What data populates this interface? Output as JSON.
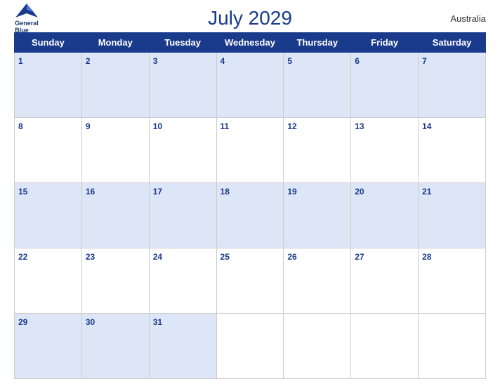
{
  "header": {
    "title": "July 2029",
    "country": "Australia",
    "logo_line1": "General",
    "logo_line2": "Blue"
  },
  "weekdays": [
    "Sunday",
    "Monday",
    "Tuesday",
    "Wednesday",
    "Thursday",
    "Friday",
    "Saturday"
  ],
  "weeks": [
    [
      1,
      2,
      3,
      4,
      5,
      6,
      7
    ],
    [
      8,
      9,
      10,
      11,
      12,
      13,
      14
    ],
    [
      15,
      16,
      17,
      18,
      19,
      20,
      21
    ],
    [
      22,
      23,
      24,
      25,
      26,
      27,
      28
    ],
    [
      29,
      30,
      31,
      null,
      null,
      null,
      null
    ]
  ]
}
